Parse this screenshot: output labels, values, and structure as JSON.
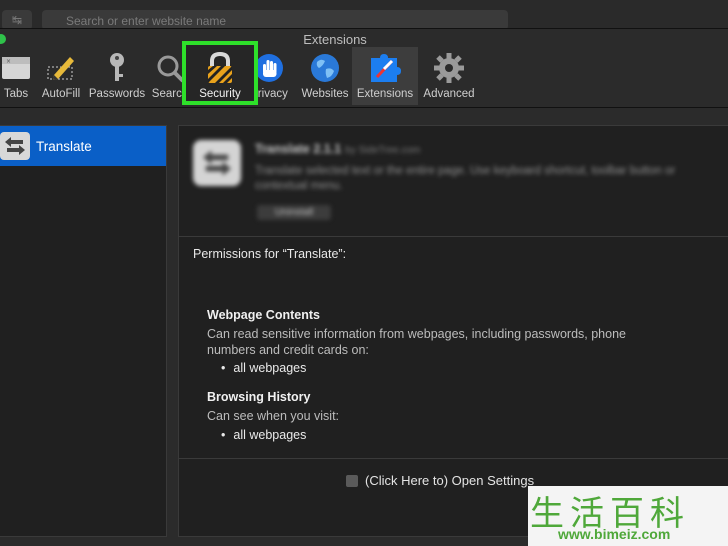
{
  "browser": {
    "url_placeholder": "Search or enter website name"
  },
  "window": {
    "title": "Extensions"
  },
  "toolbar": {
    "items": [
      {
        "label": "Tabs",
        "icon": "tabs-icon"
      },
      {
        "label": "AutoFill",
        "icon": "autofill-icon"
      },
      {
        "label": "Passwords",
        "icon": "key-icon"
      },
      {
        "label": "Search",
        "icon": "search-icon"
      },
      {
        "label": "Security",
        "icon": "lock-icon"
      },
      {
        "label": "Privacy",
        "icon": "hand-icon"
      },
      {
        "label": "Websites",
        "icon": "globe-icon"
      },
      {
        "label": "Extensions",
        "icon": "puzzle-compass-icon"
      },
      {
        "label": "Advanced",
        "icon": "gear-icon"
      }
    ],
    "highlighted": "Security",
    "active": "Extensions",
    "highlight_color": "#2ee02a"
  },
  "extensions": {
    "list": [
      {
        "name": "Translate",
        "selected": true
      }
    ],
    "selected_color": "#0a5fc7"
  },
  "detail": {
    "title": "Translate 2.1.1",
    "by": "by SideTree.com",
    "description": "Translate selected text or the entire page. Use keyboard shortcut, toolbar button or contextual menu.",
    "uninstall_label": "Uninstall",
    "permissions_title": "Permissions for “Translate”:",
    "sections": [
      {
        "heading": "Webpage Contents",
        "text": "Can read sensitive information from webpages, including passwords, phone numbers and credit cards on:",
        "bullet": "all webpages"
      },
      {
        "heading": "Browsing History",
        "text": "Can see when you visit:",
        "bullet": "all webpages"
      }
    ],
    "settings_label": "(Click Here to) Open Settings"
  },
  "watermark": {
    "logo": "生活百科",
    "url": "www.bimeiz.com"
  }
}
